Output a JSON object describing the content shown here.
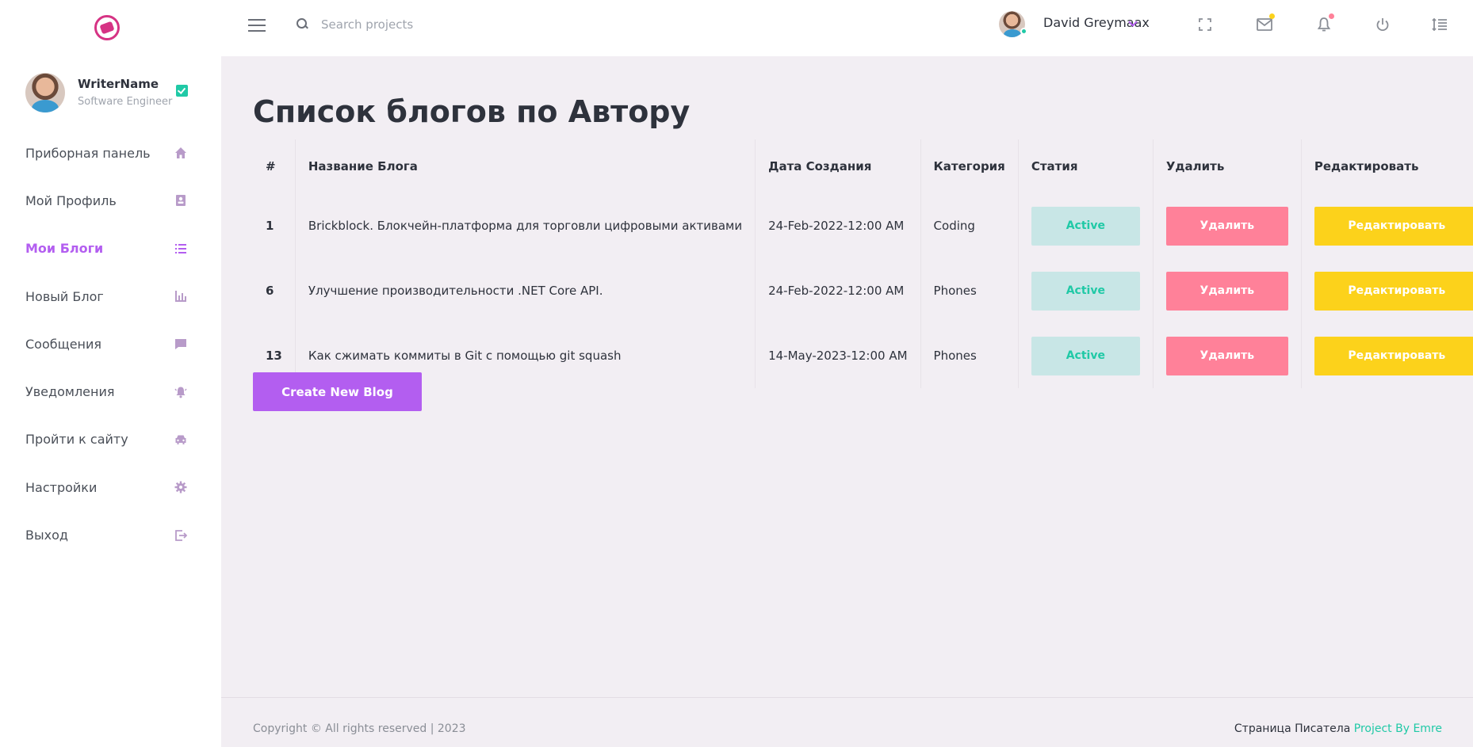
{
  "sidebar": {
    "profile": {
      "name": "WriterName",
      "role": "Software Engineer"
    },
    "items": [
      {
        "label": "Приборная панель",
        "icon": "home-icon",
        "active": false
      },
      {
        "label": "Мой Профиль",
        "icon": "profile-card-icon",
        "active": false
      },
      {
        "label": "Мои Блоги",
        "icon": "list-icon",
        "active": true
      },
      {
        "label": "Новый Блог",
        "icon": "bar-chart-icon",
        "active": false
      },
      {
        "label": "Сообщения",
        "icon": "chat-icon",
        "active": false
      },
      {
        "label": "Уведомления",
        "icon": "bell-ring-icon",
        "active": false
      },
      {
        "label": "Пройти к сайту",
        "icon": "car-icon",
        "active": false
      },
      {
        "label": "Настройки",
        "icon": "gear-icon",
        "active": false
      },
      {
        "label": "Выход",
        "icon": "logout-icon",
        "active": false
      }
    ]
  },
  "topbar": {
    "search_placeholder": "Search projects",
    "user_name": "David Greymaax"
  },
  "main": {
    "title": "Список блогов по Автору",
    "table": {
      "headers": [
        "#",
        "Название Блога",
        "Дата Создания",
        "Категория",
        "Статия",
        "Удалить",
        "Редактировать"
      ],
      "rows": [
        {
          "id": "1",
          "title": "Brickblock. Блокчейн-платформа для торговли цифровыми активами",
          "date": "24-Feb-2022-12:00 AM",
          "category": "Coding",
          "status": "Active",
          "delete": "Удалить",
          "edit": "Редактировать"
        },
        {
          "id": "6",
          "title": "Улучшение производительности .NET Core API.",
          "date": "24-Feb-2022-12:00 AM",
          "category": "Phones",
          "status": "Active",
          "delete": "Удалить",
          "edit": "Редактировать"
        },
        {
          "id": "13",
          "title": "Как сжимать коммиты в Git с помощью git squash",
          "date": "14-May-2023-12:00 AM",
          "category": "Phones",
          "status": "Active",
          "delete": "Удалить",
          "edit": "Редактировать"
        }
      ]
    },
    "create_button": "Create New Blog"
  },
  "footer": {
    "copyright": "Copyright © All rights reserved | 2023",
    "right_text": "Страница Писатела",
    "right_link": "Project By Emre"
  },
  "colors": {
    "accent": "#b35ef0",
    "teal": "#20c9a6",
    "delete": "#ff8199",
    "edit": "#fcd21b",
    "background": "#f2eef3"
  }
}
